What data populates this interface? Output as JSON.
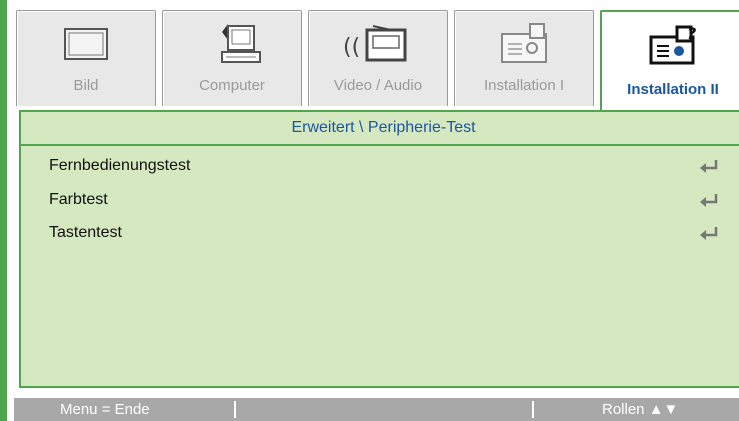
{
  "tabs": [
    {
      "label": "Bild",
      "icon": "monitor-icon",
      "active": false
    },
    {
      "label": "Computer",
      "icon": "computer-icon",
      "active": false
    },
    {
      "label": "Video / Audio",
      "icon": "video-audio-icon",
      "active": false
    },
    {
      "label": "Installation I",
      "icon": "projector-icon",
      "active": false
    },
    {
      "label": "Installation II",
      "icon": "projector-help-icon",
      "active": true
    }
  ],
  "panel": {
    "title": "Erweitert \\ Peripherie-Test",
    "items": [
      {
        "label": "Fernbedienungstest",
        "icon": "enter-icon"
      },
      {
        "label": "Farbtest",
        "icon": "enter-icon"
      },
      {
        "label": "Tastentest",
        "icon": "enter-icon"
      }
    ]
  },
  "statusbar": {
    "left": "Menu = Ende",
    "right": "Rollen ▲▼"
  },
  "colors": {
    "accent_green": "#4fa64f",
    "panel_bg": "#d5e8c0",
    "active_text": "#1b56a3",
    "inactive_text": "#9a9a9a",
    "statusbar_bg": "#a8a8a8"
  }
}
